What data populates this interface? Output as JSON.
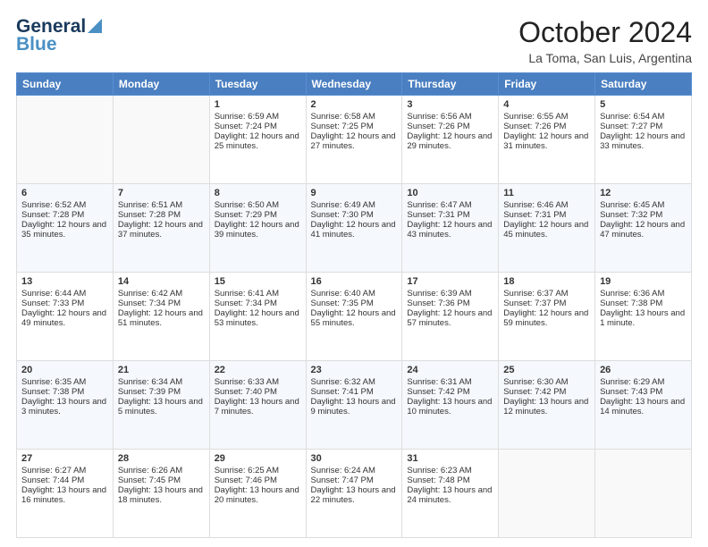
{
  "header": {
    "logo_general": "General",
    "logo_blue": "Blue",
    "month_title": "October 2024",
    "location": "La Toma, San Luis, Argentina"
  },
  "days_of_week": [
    "Sunday",
    "Monday",
    "Tuesday",
    "Wednesday",
    "Thursday",
    "Friday",
    "Saturday"
  ],
  "weeks": [
    [
      {
        "day": "",
        "sunrise": "",
        "sunset": "",
        "daylight": ""
      },
      {
        "day": "",
        "sunrise": "",
        "sunset": "",
        "daylight": ""
      },
      {
        "day": "1",
        "sunrise": "Sunrise: 6:59 AM",
        "sunset": "Sunset: 7:24 PM",
        "daylight": "Daylight: 12 hours and 25 minutes."
      },
      {
        "day": "2",
        "sunrise": "Sunrise: 6:58 AM",
        "sunset": "Sunset: 7:25 PM",
        "daylight": "Daylight: 12 hours and 27 minutes."
      },
      {
        "day": "3",
        "sunrise": "Sunrise: 6:56 AM",
        "sunset": "Sunset: 7:26 PM",
        "daylight": "Daylight: 12 hours and 29 minutes."
      },
      {
        "day": "4",
        "sunrise": "Sunrise: 6:55 AM",
        "sunset": "Sunset: 7:26 PM",
        "daylight": "Daylight: 12 hours and 31 minutes."
      },
      {
        "day": "5",
        "sunrise": "Sunrise: 6:54 AM",
        "sunset": "Sunset: 7:27 PM",
        "daylight": "Daylight: 12 hours and 33 minutes."
      }
    ],
    [
      {
        "day": "6",
        "sunrise": "Sunrise: 6:52 AM",
        "sunset": "Sunset: 7:28 PM",
        "daylight": "Daylight: 12 hours and 35 minutes."
      },
      {
        "day": "7",
        "sunrise": "Sunrise: 6:51 AM",
        "sunset": "Sunset: 7:28 PM",
        "daylight": "Daylight: 12 hours and 37 minutes."
      },
      {
        "day": "8",
        "sunrise": "Sunrise: 6:50 AM",
        "sunset": "Sunset: 7:29 PM",
        "daylight": "Daylight: 12 hours and 39 minutes."
      },
      {
        "day": "9",
        "sunrise": "Sunrise: 6:49 AM",
        "sunset": "Sunset: 7:30 PM",
        "daylight": "Daylight: 12 hours and 41 minutes."
      },
      {
        "day": "10",
        "sunrise": "Sunrise: 6:47 AM",
        "sunset": "Sunset: 7:31 PM",
        "daylight": "Daylight: 12 hours and 43 minutes."
      },
      {
        "day": "11",
        "sunrise": "Sunrise: 6:46 AM",
        "sunset": "Sunset: 7:31 PM",
        "daylight": "Daylight: 12 hours and 45 minutes."
      },
      {
        "day": "12",
        "sunrise": "Sunrise: 6:45 AM",
        "sunset": "Sunset: 7:32 PM",
        "daylight": "Daylight: 12 hours and 47 minutes."
      }
    ],
    [
      {
        "day": "13",
        "sunrise": "Sunrise: 6:44 AM",
        "sunset": "Sunset: 7:33 PM",
        "daylight": "Daylight: 12 hours and 49 minutes."
      },
      {
        "day": "14",
        "sunrise": "Sunrise: 6:42 AM",
        "sunset": "Sunset: 7:34 PM",
        "daylight": "Daylight: 12 hours and 51 minutes."
      },
      {
        "day": "15",
        "sunrise": "Sunrise: 6:41 AM",
        "sunset": "Sunset: 7:34 PM",
        "daylight": "Daylight: 12 hours and 53 minutes."
      },
      {
        "day": "16",
        "sunrise": "Sunrise: 6:40 AM",
        "sunset": "Sunset: 7:35 PM",
        "daylight": "Daylight: 12 hours and 55 minutes."
      },
      {
        "day": "17",
        "sunrise": "Sunrise: 6:39 AM",
        "sunset": "Sunset: 7:36 PM",
        "daylight": "Daylight: 12 hours and 57 minutes."
      },
      {
        "day": "18",
        "sunrise": "Sunrise: 6:37 AM",
        "sunset": "Sunset: 7:37 PM",
        "daylight": "Daylight: 12 hours and 59 minutes."
      },
      {
        "day": "19",
        "sunrise": "Sunrise: 6:36 AM",
        "sunset": "Sunset: 7:38 PM",
        "daylight": "Daylight: 13 hours and 1 minute."
      }
    ],
    [
      {
        "day": "20",
        "sunrise": "Sunrise: 6:35 AM",
        "sunset": "Sunset: 7:38 PM",
        "daylight": "Daylight: 13 hours and 3 minutes."
      },
      {
        "day": "21",
        "sunrise": "Sunrise: 6:34 AM",
        "sunset": "Sunset: 7:39 PM",
        "daylight": "Daylight: 13 hours and 5 minutes."
      },
      {
        "day": "22",
        "sunrise": "Sunrise: 6:33 AM",
        "sunset": "Sunset: 7:40 PM",
        "daylight": "Daylight: 13 hours and 7 minutes."
      },
      {
        "day": "23",
        "sunrise": "Sunrise: 6:32 AM",
        "sunset": "Sunset: 7:41 PM",
        "daylight": "Daylight: 13 hours and 9 minutes."
      },
      {
        "day": "24",
        "sunrise": "Sunrise: 6:31 AM",
        "sunset": "Sunset: 7:42 PM",
        "daylight": "Daylight: 13 hours and 10 minutes."
      },
      {
        "day": "25",
        "sunrise": "Sunrise: 6:30 AM",
        "sunset": "Sunset: 7:42 PM",
        "daylight": "Daylight: 13 hours and 12 minutes."
      },
      {
        "day": "26",
        "sunrise": "Sunrise: 6:29 AM",
        "sunset": "Sunset: 7:43 PM",
        "daylight": "Daylight: 13 hours and 14 minutes."
      }
    ],
    [
      {
        "day": "27",
        "sunrise": "Sunrise: 6:27 AM",
        "sunset": "Sunset: 7:44 PM",
        "daylight": "Daylight: 13 hours and 16 minutes."
      },
      {
        "day": "28",
        "sunrise": "Sunrise: 6:26 AM",
        "sunset": "Sunset: 7:45 PM",
        "daylight": "Daylight: 13 hours and 18 minutes."
      },
      {
        "day": "29",
        "sunrise": "Sunrise: 6:25 AM",
        "sunset": "Sunset: 7:46 PM",
        "daylight": "Daylight: 13 hours and 20 minutes."
      },
      {
        "day": "30",
        "sunrise": "Sunrise: 6:24 AM",
        "sunset": "Sunset: 7:47 PM",
        "daylight": "Daylight: 13 hours and 22 minutes."
      },
      {
        "day": "31",
        "sunrise": "Sunrise: 6:23 AM",
        "sunset": "Sunset: 7:48 PM",
        "daylight": "Daylight: 13 hours and 24 minutes."
      },
      {
        "day": "",
        "sunrise": "",
        "sunset": "",
        "daylight": ""
      },
      {
        "day": "",
        "sunrise": "",
        "sunset": "",
        "daylight": ""
      }
    ]
  ]
}
